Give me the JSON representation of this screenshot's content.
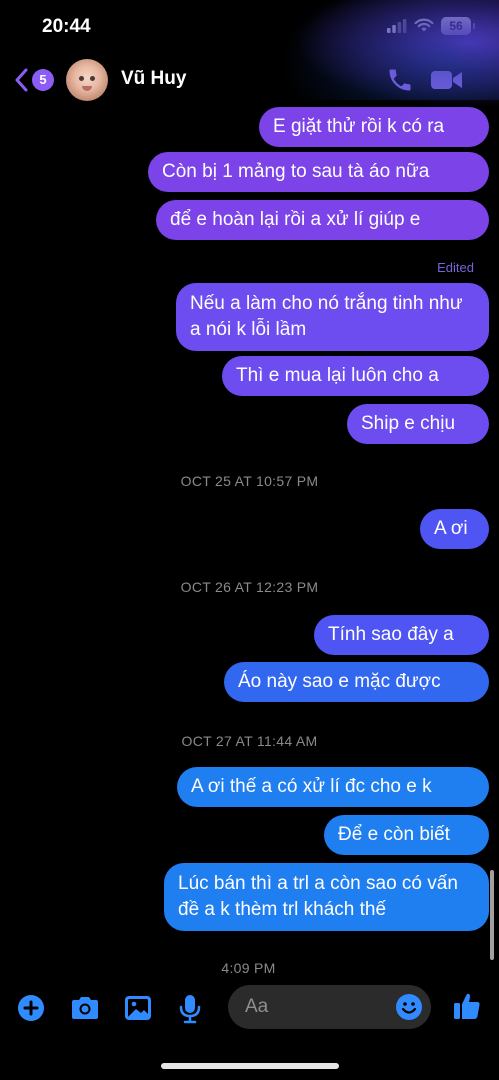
{
  "status": {
    "time": "20:44",
    "battery": "56"
  },
  "header": {
    "back_badge": "5",
    "contact_name": "Vũ Huy"
  },
  "messages": [
    "E giặt thử rồi k có ra",
    "Còn bị 1 mảng to sau tà áo nữa",
    "để e hoàn lại rồi a xử lí giúp e",
    "Nếu a làm cho nó trắng tinh như a nói k lỗi lầm",
    "Thì e mua lại luôn cho a",
    "Ship e chịu",
    "A ơi",
    "Tính sao đây a",
    "Áo này sao e mặc được",
    "A ơi thế a có xử lí đc cho e k",
    "Để e còn biết",
    "Lúc bán thì a trl a còn sao có vấn đề a k thèm trl khách thế"
  ],
  "edited_label": "Edited",
  "timestamps": [
    "OCT 25 AT 10:57 PM",
    "OCT 26 AT 12:23 PM",
    "OCT 27 AT 11:44 AM",
    "4:09 PM"
  ],
  "composer": {
    "placeholder": "Aa"
  },
  "colors": {
    "accent": "#8b5cf6",
    "bubble_purple": "#7b43e8",
    "bubble_blue": "#1f7ef0",
    "icon_blue": "#2f8bff"
  }
}
